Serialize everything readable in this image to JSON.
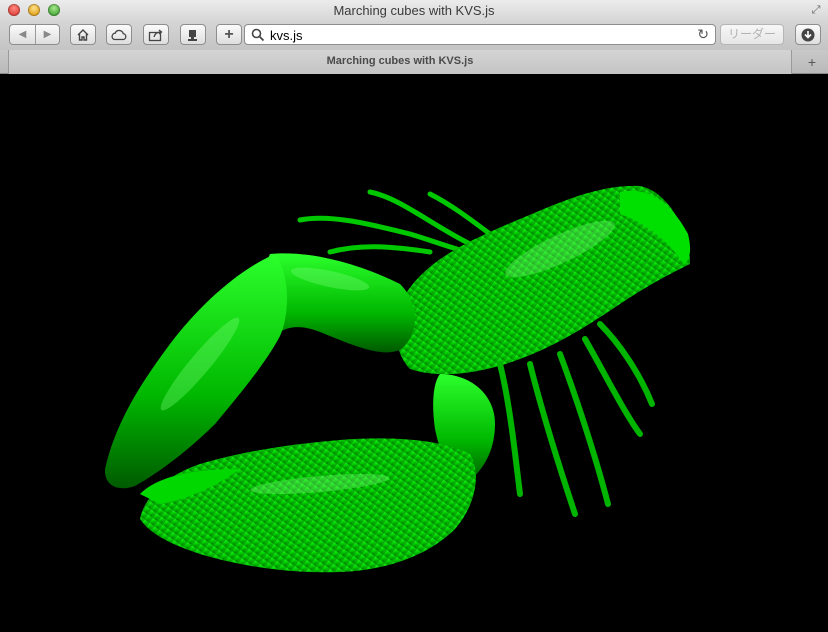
{
  "window": {
    "title": "Marching cubes with KVS.js"
  },
  "toolbar": {
    "back_icon": "back-arrow-icon",
    "forward_icon": "forward-arrow-icon",
    "home_icon": "home-icon",
    "cloud_icon": "icloud-tabs-icon",
    "share_icon": "share-icon",
    "add_icon": "plus-icon",
    "download_icon": "download-icon"
  },
  "address_bar": {
    "url": "kvs.js",
    "reader_label": "リーダー"
  },
  "tabs": [
    {
      "title": "Marching cubes with KVS.js"
    }
  ],
  "content": {
    "description_color": "#00ff00",
    "background_color": "#000000"
  }
}
